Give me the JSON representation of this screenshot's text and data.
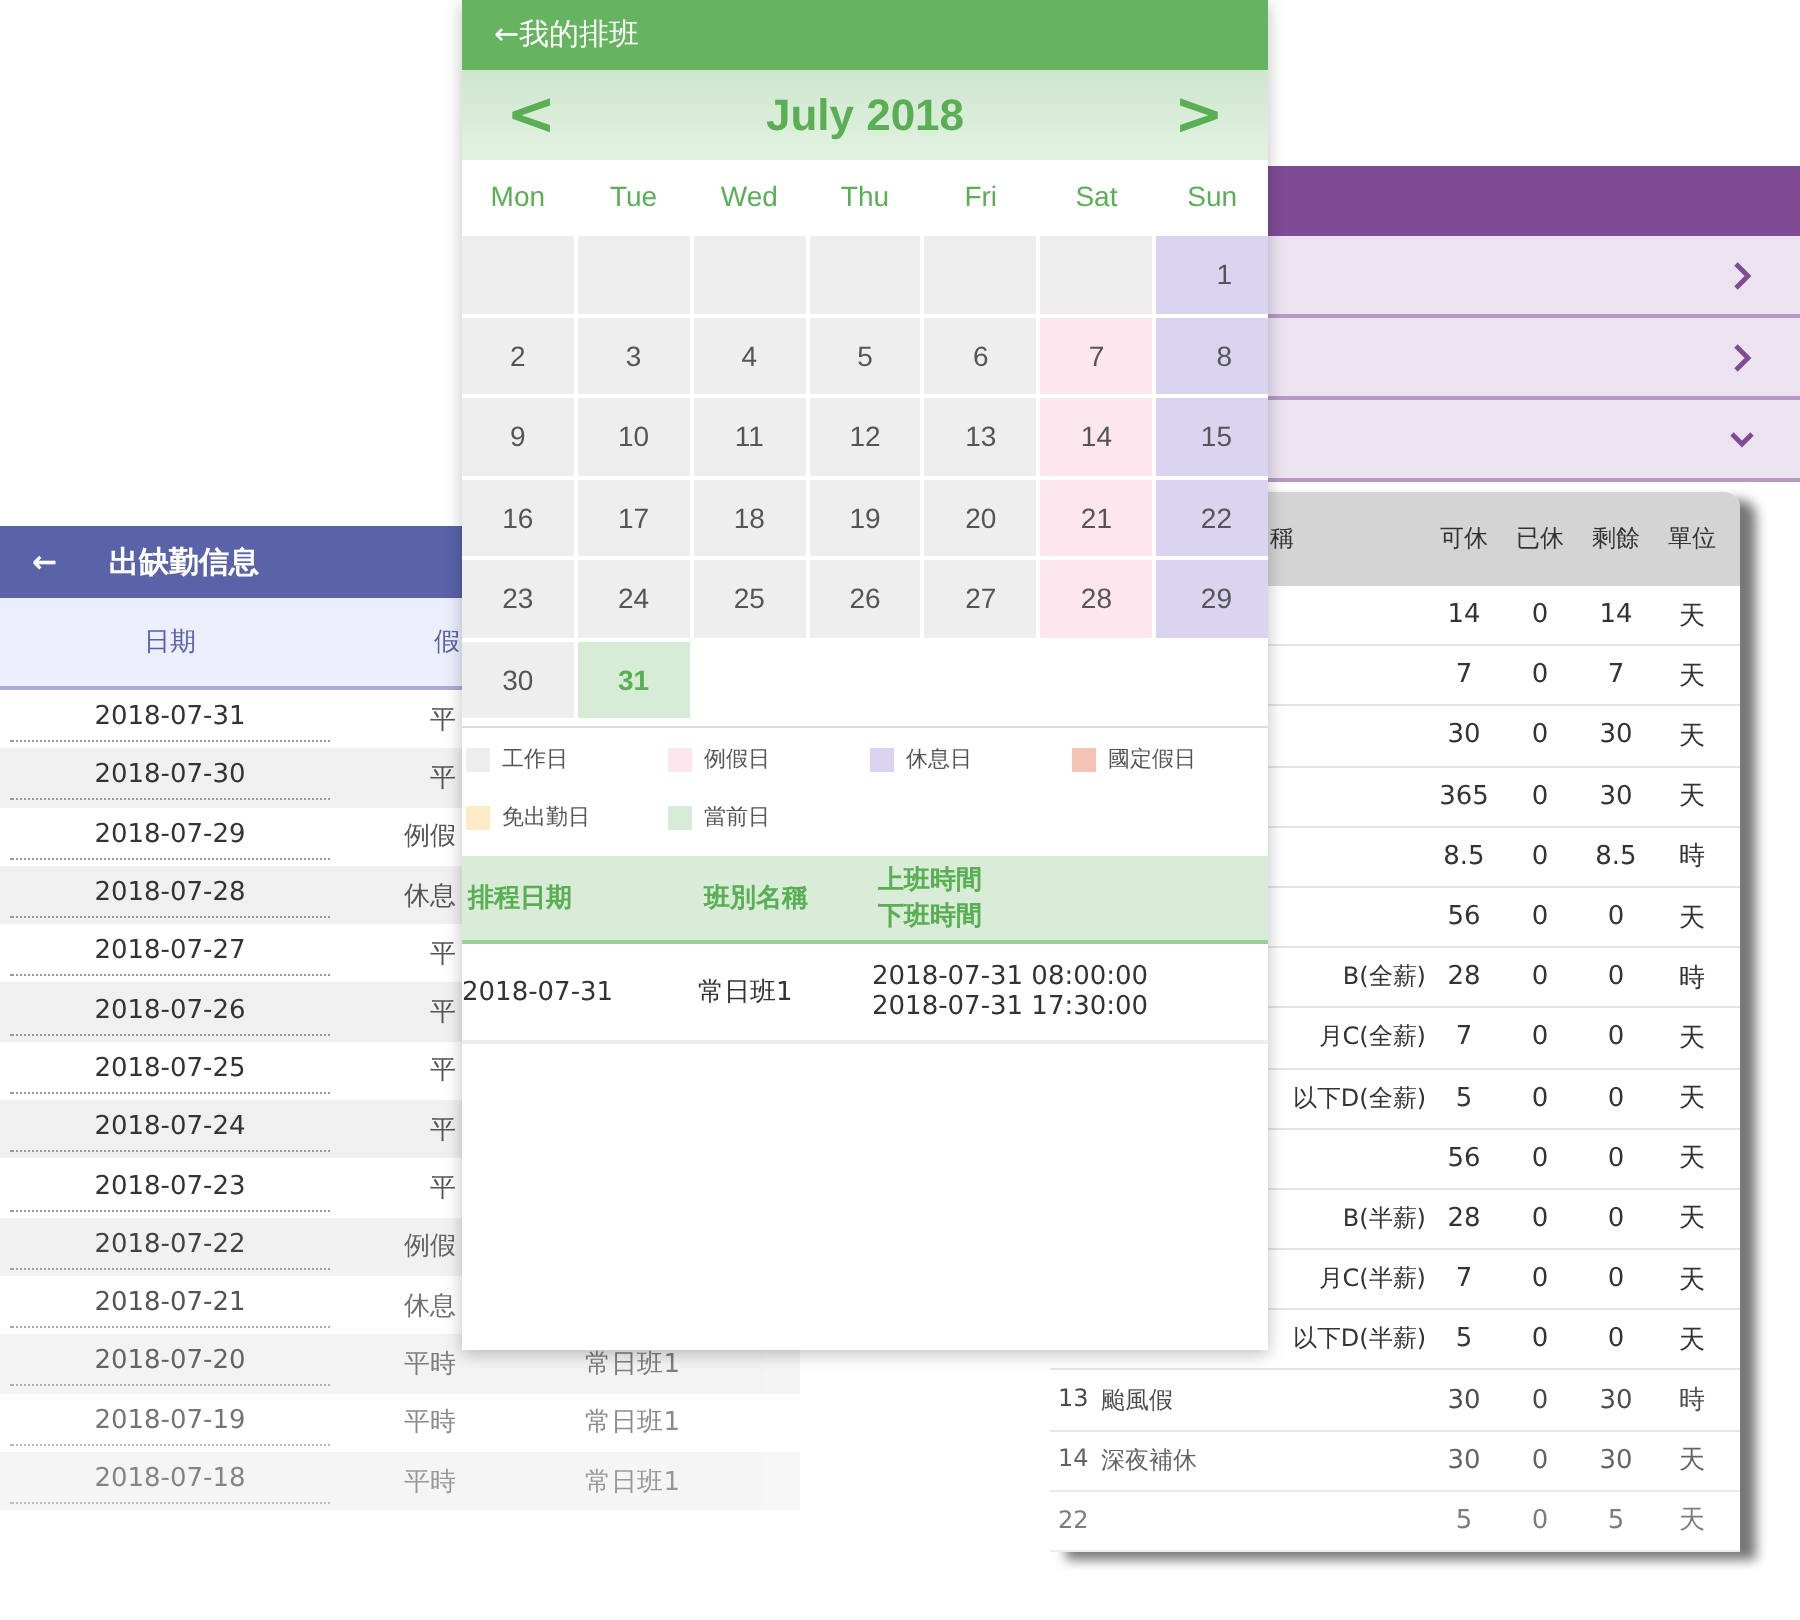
{
  "attendance": {
    "title": "出缺勤信息",
    "back": "←",
    "columns": [
      "日期",
      "假"
    ],
    "rows": [
      {
        "date": "2018-07-31",
        "type": "平"
      },
      {
        "date": "2018-07-30",
        "type": "平"
      },
      {
        "date": "2018-07-29",
        "type": "例假"
      },
      {
        "date": "2018-07-28",
        "type": "休息"
      },
      {
        "date": "2018-07-27",
        "type": "平"
      },
      {
        "date": "2018-07-26",
        "type": "平"
      },
      {
        "date": "2018-07-25",
        "type": "平"
      },
      {
        "date": "2018-07-24",
        "type": "平"
      },
      {
        "date": "2018-07-23",
        "type": "平"
      },
      {
        "date": "2018-07-22",
        "type": "例假"
      },
      {
        "date": "2018-07-21",
        "type": "休息"
      },
      {
        "date": "2018-07-20",
        "type": "平時",
        "shift": "常日班1"
      },
      {
        "date": "2018-07-19",
        "type": "平時",
        "shift": "常日班1"
      },
      {
        "date": "2018-07-18",
        "type": "平時",
        "shift": "常日班1"
      }
    ]
  },
  "leave": {
    "sections": [
      {
        "expanded": false
      },
      {
        "expanded": false
      },
      {
        "expanded": true
      }
    ],
    "columns": [
      "稱",
      "可休",
      "已休",
      "剩餘",
      "單位"
    ],
    "rows": [
      {
        "values": [
          "14",
          "0",
          "14",
          "天"
        ]
      },
      {
        "values": [
          "7",
          "0",
          "7",
          "天"
        ]
      },
      {
        "values": [
          "30",
          "0",
          "30",
          "天"
        ]
      },
      {
        "values": [
          "365",
          "0",
          "30",
          "天"
        ]
      },
      {
        "values": [
          "8.5",
          "0",
          "8.5",
          "時"
        ]
      },
      {
        "values": [
          "56",
          "0",
          "0",
          "天"
        ]
      },
      {
        "name": "B(全薪)",
        "values": [
          "28",
          "0",
          "0",
          "時"
        ]
      },
      {
        "name": "月C(全薪)",
        "values": [
          "7",
          "0",
          "0",
          "天"
        ]
      },
      {
        "name": "以下D(全薪)",
        "values": [
          "5",
          "0",
          "0",
          "天"
        ]
      },
      {
        "values": [
          "56",
          "0",
          "0",
          "天"
        ]
      },
      {
        "name": "B(半薪)",
        "values": [
          "28",
          "0",
          "0",
          "天"
        ]
      },
      {
        "name": "月C(半薪)",
        "values": [
          "7",
          "0",
          "0",
          "天"
        ]
      },
      {
        "name": "以下D(半薪)",
        "values": [
          "5",
          "0",
          "0",
          "天"
        ]
      },
      {
        "no": "13",
        "name": "颱風假",
        "values": [
          "30",
          "0",
          "30",
          "時"
        ]
      },
      {
        "no": "14",
        "name": "深夜補休",
        "values": [
          "30",
          "0",
          "30",
          "天"
        ]
      },
      {
        "no": "22",
        "values": [
          "5",
          "0",
          "5",
          "天"
        ]
      }
    ]
  },
  "schedule": {
    "title": "←我的排班",
    "prev": "<",
    "next": ">",
    "month": "July 2018",
    "weekdays": [
      "Mon",
      "Tue",
      "Wed",
      "Thu",
      "Fri",
      "Sat",
      "Sun"
    ],
    "weeks": [
      [
        {
          "kind": "work"
        },
        {
          "kind": "work"
        },
        {
          "kind": "work"
        },
        {
          "kind": "work"
        },
        {
          "kind": "work"
        },
        {
          "kind": "work"
        },
        {
          "day": "1",
          "kind": "rest"
        }
      ],
      [
        {
          "day": "2",
          "kind": "work"
        },
        {
          "day": "3",
          "kind": "work"
        },
        {
          "day": "4",
          "kind": "work"
        },
        {
          "day": "5",
          "kind": "work"
        },
        {
          "day": "6",
          "kind": "work"
        },
        {
          "day": "7",
          "kind": "regular"
        },
        {
          "day": "8",
          "kind": "rest"
        }
      ],
      [
        {
          "day": "9",
          "kind": "work"
        },
        {
          "day": "10",
          "kind": "work"
        },
        {
          "day": "11",
          "kind": "work"
        },
        {
          "day": "12",
          "kind": "work"
        },
        {
          "day": "13",
          "kind": "work"
        },
        {
          "day": "14",
          "kind": "regular"
        },
        {
          "day": "15",
          "kind": "rest"
        }
      ],
      [
        {
          "day": "16",
          "kind": "work"
        },
        {
          "day": "17",
          "kind": "work"
        },
        {
          "day": "18",
          "kind": "work"
        },
        {
          "day": "19",
          "kind": "work"
        },
        {
          "day": "20",
          "kind": "work"
        },
        {
          "day": "21",
          "kind": "regular"
        },
        {
          "day": "22",
          "kind": "rest"
        }
      ],
      [
        {
          "day": "23",
          "kind": "work"
        },
        {
          "day": "24",
          "kind": "work"
        },
        {
          "day": "25",
          "kind": "work"
        },
        {
          "day": "26",
          "kind": "work"
        },
        {
          "day": "27",
          "kind": "work"
        },
        {
          "day": "28",
          "kind": "regular"
        },
        {
          "day": "29",
          "kind": "rest"
        }
      ],
      [
        {
          "day": "30",
          "kind": "work"
        },
        {
          "day": "31",
          "kind": "today"
        },
        {
          "kind": "none"
        },
        {
          "kind": "none"
        },
        {
          "kind": "none"
        },
        {
          "kind": "none"
        },
        {
          "kind": "none"
        }
      ]
    ],
    "legend": [
      {
        "label": "工作日",
        "color": "#eeeeee"
      },
      {
        "label": "例假日",
        "color": "#fde6ee"
      },
      {
        "label": "休息日",
        "color": "#dad4f0"
      },
      {
        "label": "國定假日",
        "color": "#f4c4b4"
      },
      {
        "label": "免出勤日",
        "color": "#fcebc6"
      },
      {
        "label": "當前日",
        "color": "#d6ecd6"
      }
    ],
    "table": {
      "columns": [
        "排程日期",
        "班別名稱"
      ],
      "time_header": [
        "上班時間",
        "下班時間"
      ],
      "rows": [
        {
          "date": "2018-07-31",
          "shift": "常日班1",
          "start": "2018-07-31 08:00:00",
          "end": "2018-07-31 17:30:00"
        }
      ]
    }
  }
}
